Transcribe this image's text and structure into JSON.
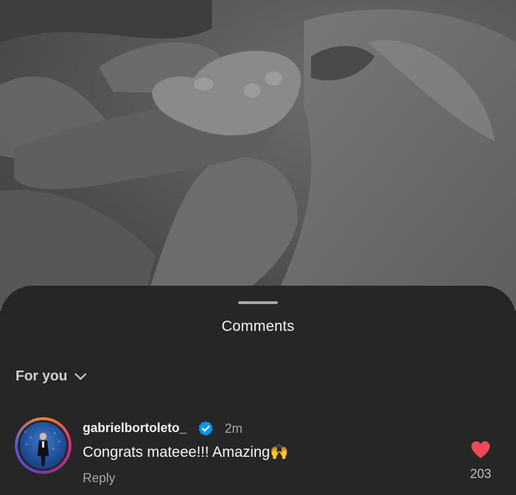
{
  "photo": {
    "icon": "baby-hand-photo"
  },
  "sheet": {
    "title": "Comments",
    "filter": {
      "label": "For you",
      "icon": "chevron-down-icon"
    }
  },
  "comments": [
    {
      "username": "gabrielbortoleto_",
      "verified": true,
      "time": "2m",
      "text": "Congrats mateee!!! Amazing🙌",
      "reply_label": "Reply",
      "like_count": "203",
      "liked": true
    }
  ],
  "colors": {
    "like": "#ed4956",
    "verified": "#0095f6",
    "sheet_bg": "#262626"
  }
}
